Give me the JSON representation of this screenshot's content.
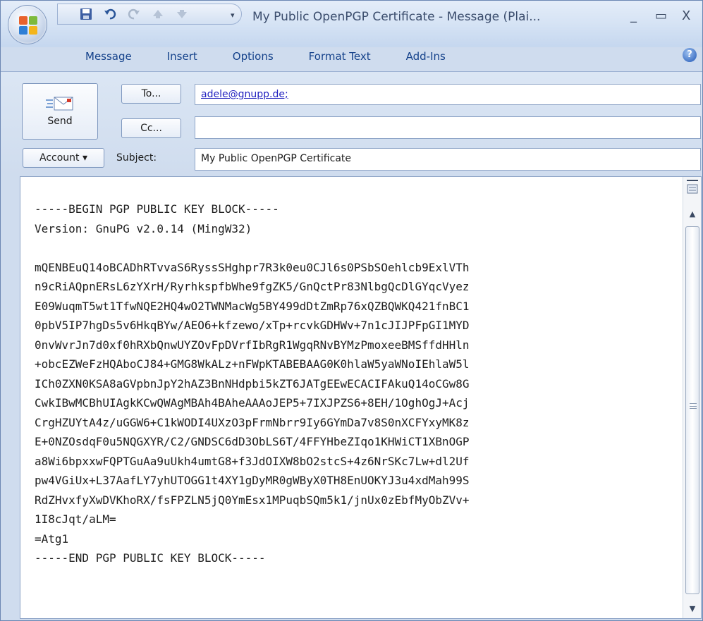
{
  "window": {
    "title": "My Public OpenPGP Certificate - Message (Plai...",
    "controls": {
      "minimize": "_",
      "maximize": "▭",
      "close": "X"
    }
  },
  "quick_access": {
    "icons": [
      "save-icon",
      "undo-icon",
      "redo-icon",
      "previous-item-icon",
      "next-item-icon"
    ],
    "dropdown": "▾"
  },
  "ribbon": {
    "tabs": [
      "Message",
      "Insert",
      "Options",
      "Format Text",
      "Add-Ins"
    ],
    "help": "?"
  },
  "header": {
    "send_label": "Send",
    "to_button": "To...",
    "cc_button": "Cc...",
    "account_button": "Account ▾",
    "subject_label": "Subject:",
    "to_value": "adele@gnupp.de;",
    "cc_value": "",
    "subject_value": "My Public OpenPGP Certificate"
  },
  "body": {
    "lines": [
      "-----BEGIN PGP PUBLIC KEY BLOCK-----",
      "Version: GnuPG v2.0.14 (MingW32)",
      "",
      "mQENBEuQ14oBCADhRTvvaS6RyssSHghpr7R3k0eu0CJl6s0PSbSOehlcb9ExlVTh",
      "n9cRiAQpnERsL6zYXrH/RyrhkspfbWhe9fgZK5/GnQctPr83NlbgQcDlGYqcVyez",
      "E09WuqmT5wt1TfwNQE2HQ4wO2TWNMacWg5BY499dDtZmRp76xQZBQWKQ421fnBC1",
      "0pbV5IP7hgDs5v6HkqBYw/AEO6+kfzewo/xTp+rcvkGDHWv+7n1cJIJPFpGI1MYD",
      "0nvWvrJn7d0xf0hRXbQnwUYZOvFpDVrfIbRgR1WgqRNvBYMzPmoxeeBMSffdHHln",
      "+obcEZWeFzHQAboCJ84+GMG8WkALz+nFWpKTABEBAAG0K0hlaW5yaWNoIEhlaW5l",
      "ICh0ZXN0KSA8aGVpbnJpY2hAZ3BnNHdpbi5kZT6JATgEEwECACIFAkuQ14oCGw8G",
      "CwkIBwMCBhUIAgkKCwQWAgMBAh4BAheAAAoJEP5+7IXJPZS6+8EH/1OghOgJ+Acj",
      "CrgHZUYtA4z/uGGW6+C1kWODI4UXzO3pFrmNbrr9Iy6GYmDa7v8S0nXCFYxyMK8z",
      "E+0NZOsdqF0u5NQGXYR/C2/GNDSC6dD3ObLS6T/4FFYHbeZIqo1KHWiCT1XBnOGP",
      "a8Wi6bpxxwFQPTGuAa9uUkh4umtG8+f3JdOIXW8bO2stcS+4z6NrSKc7Lw+dl2Uf",
      "pw4VGiUx+L37AafLY7yhUTOGG1t4XY1gDyMR0gWByX0TH8EnUOKYJ3u4xdMah99S",
      "RdZHvxfyXwDVKhoRX/fsFPZLN5jQ0YmEsx1MPuqbSQm5k1/jnUx0zEbfMyObZVv+",
      "1I8cJqt/aLM=",
      "=Atg1",
      "-----END PGP PUBLIC KEY BLOCK-----"
    ]
  }
}
